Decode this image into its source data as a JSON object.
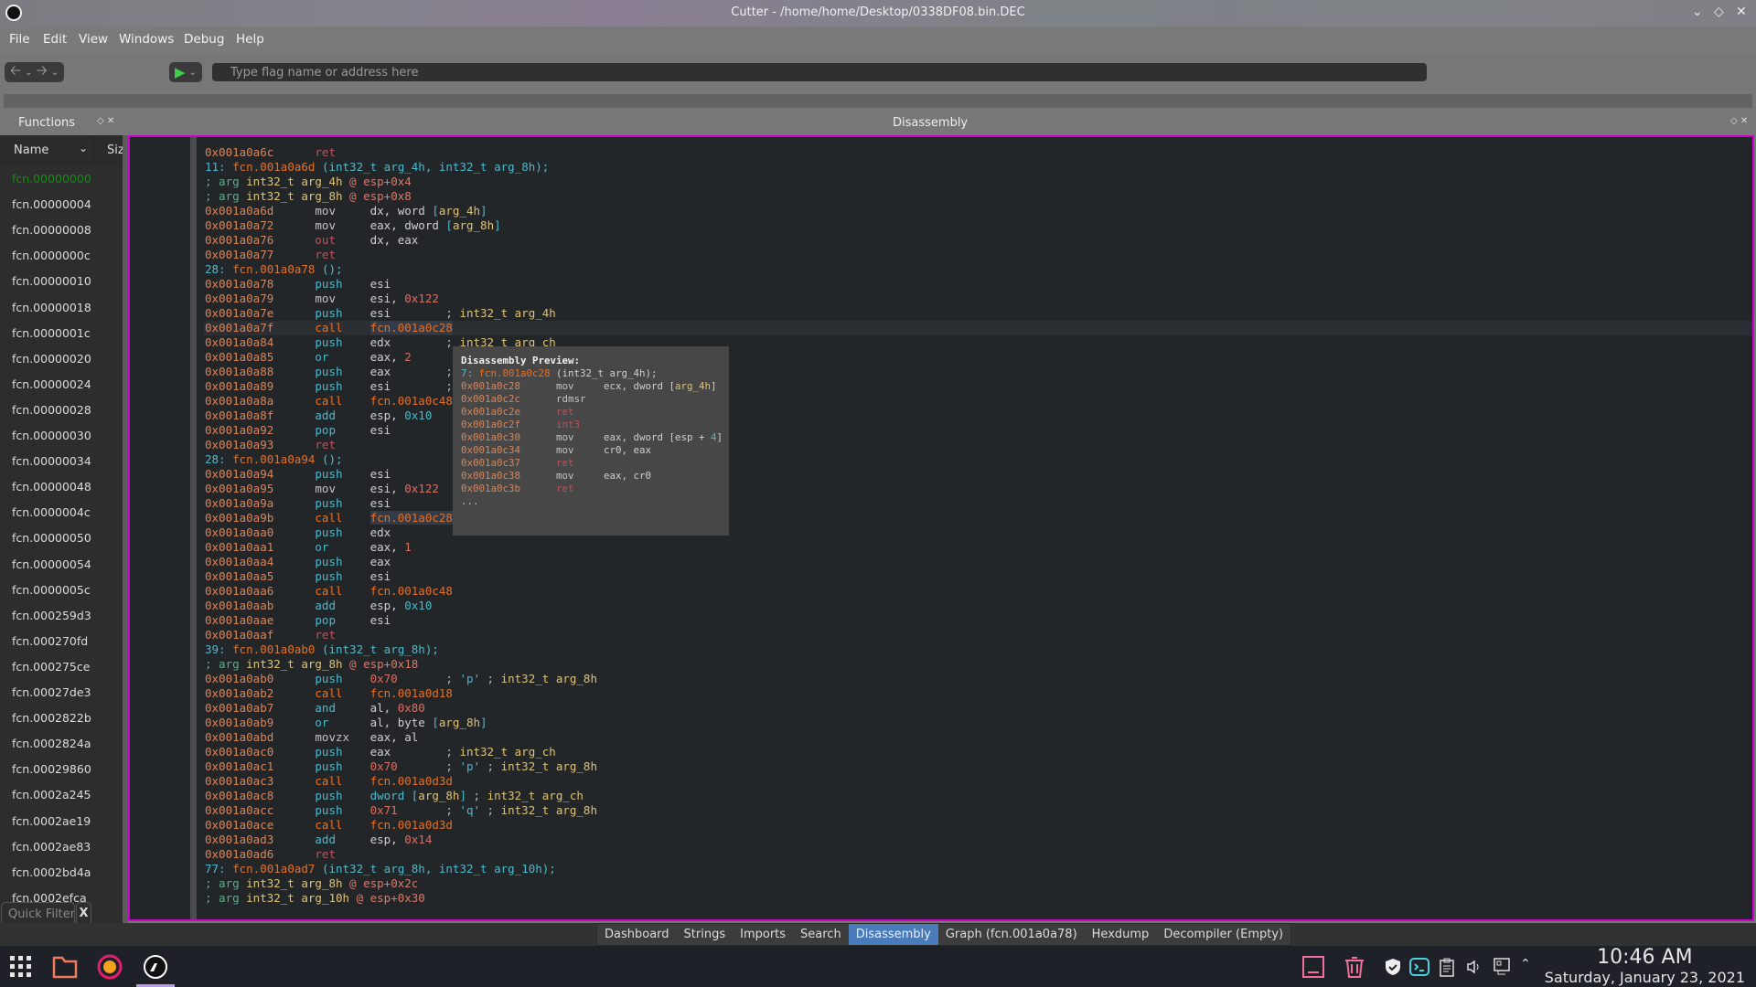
{
  "window": {
    "title": "Cutter - /home/home/Desktop/0338DF08.bin.DEC"
  },
  "menu": [
    "File",
    "Edit",
    "View",
    "Windows",
    "Debug",
    "Help"
  ],
  "toolbar": {
    "search_placeholder": "Type flag name or address here"
  },
  "functions_dock": {
    "title": "Functions",
    "col_name": "Name",
    "col_size": "Siz",
    "current": "fcn.00000000",
    "items": [
      "fcn.00000000",
      "fcn.00000004",
      "fcn.00000008",
      "fcn.0000000c",
      "fcn.00000010",
      "fcn.00000018",
      "fcn.0000001c",
      "fcn.00000020",
      "fcn.00000024",
      "fcn.00000028",
      "fcn.00000030",
      "fcn.00000034",
      "fcn.00000048",
      "fcn.0000004c",
      "fcn.00000050",
      "fcn.00000054",
      "fcn.0000005c",
      "fcn.000259d3",
      "fcn.000270fd",
      "fcn.000275ce",
      "fcn.00027de3",
      "fcn.0002822b",
      "fcn.0002824a",
      "fcn.00029860",
      "fcn.0002a245",
      "fcn.0002ae19",
      "fcn.0002ae83",
      "fcn.0002bd4a",
      "fcn.0002efca"
    ],
    "quick_filter_placeholder": "Quick Filter",
    "clear_label": "X"
  },
  "disassembly_dock": {
    "title": "Disassembly"
  },
  "disassembly": [
    {
      "addr": "0x001a0a6c",
      "mn": "ret",
      "k": "ret"
    },
    {
      "hdr": "11",
      "fcn": "fcn.001a0a6d",
      "sig": "(int32_t arg_4h, int32_t arg_8h);"
    },
    {
      "arg": "int32_t arg_4h",
      "at": "@ esp+0x4"
    },
    {
      "arg": "int32_t arg_8h",
      "at": "@ esp+0x8"
    },
    {
      "addr": "0x001a0a6d",
      "mn": "mov",
      "k": "mov",
      "ops": [
        [
          "dx, word ",
          "t"
        ],
        [
          "[",
          "b"
        ],
        [
          "arg_4h",
          "a"
        ],
        [
          "]",
          "b"
        ]
      ]
    },
    {
      "addr": "0x001a0a72",
      "mn": "mov",
      "k": "mov",
      "ops": [
        [
          "eax, dword ",
          "t"
        ],
        [
          "[",
          "b"
        ],
        [
          "arg_8h",
          "a"
        ],
        [
          "]",
          "b"
        ]
      ]
    },
    {
      "addr": "0x001a0a76",
      "mn": "out",
      "k": "ret",
      "ops": [
        [
          "dx, eax",
          "t"
        ]
      ]
    },
    {
      "addr": "0x001a0a77",
      "mn": "ret",
      "k": "ret"
    },
    {
      "hdr": "28",
      "fcn": "fcn.001a0a78",
      "sig": "();"
    },
    {
      "addr": "0x001a0a78",
      "mn": "push",
      "k": "push",
      "ops": [
        [
          "esi",
          "t"
        ]
      ]
    },
    {
      "addr": "0x001a0a79",
      "mn": "mov",
      "k": "mov",
      "ops": [
        [
          "esi, ",
          "t"
        ],
        [
          "0x122",
          "n"
        ]
      ]
    },
    {
      "addr": "0x001a0a7e",
      "mn": "push",
      "k": "push",
      "ops": [
        [
          "esi",
          "t"
        ]
      ],
      "cm": "int32_t arg_4h"
    },
    {
      "addr": "0x001a0a7f",
      "mn": "call",
      "k": "call",
      "ops": [
        [
          "fcn.001a0c28",
          "fh"
        ]
      ],
      "hl": true
    },
    {
      "addr": "0x001a0a84",
      "mn": "push",
      "k": "push",
      "ops": [
        [
          "edx",
          "t"
        ]
      ],
      "cm": "int32_t arg_ch"
    },
    {
      "addr": "0x001a0a85",
      "mn": "or",
      "k": "push",
      "ops": [
        [
          "eax, ",
          "t"
        ],
        [
          "2",
          "n"
        ]
      ]
    },
    {
      "addr": "0x001a0a88",
      "mn": "push",
      "k": "push",
      "ops": [
        [
          "eax",
          "t"
        ]
      ],
      "cm": ""
    },
    {
      "addr": "0x001a0a89",
      "mn": "push",
      "k": "push",
      "ops": [
        [
          "esi",
          "t"
        ]
      ],
      "cm": ""
    },
    {
      "addr": "0x001a0a8a",
      "mn": "call",
      "k": "call",
      "ops": [
        [
          "fcn.001a0c48",
          "f"
        ]
      ]
    },
    {
      "addr": "0x001a0a8f",
      "mn": "add",
      "k": "push",
      "ops": [
        [
          "esp, ",
          "t"
        ],
        [
          "0x10",
          "nc"
        ]
      ]
    },
    {
      "addr": "0x001a0a92",
      "mn": "pop",
      "k": "push",
      "ops": [
        [
          "esi",
          "t"
        ]
      ]
    },
    {
      "addr": "0x001a0a93",
      "mn": "ret",
      "k": "ret"
    },
    {
      "hdr": "28",
      "fcn": "fcn.001a0a94",
      "sig": "();"
    },
    {
      "addr": "0x001a0a94",
      "mn": "push",
      "k": "push",
      "ops": [
        [
          "esi",
          "t"
        ]
      ]
    },
    {
      "addr": "0x001a0a95",
      "mn": "mov",
      "k": "mov",
      "ops": [
        [
          "esi, ",
          "t"
        ],
        [
          "0x122",
          "n"
        ]
      ]
    },
    {
      "addr": "0x001a0a9a",
      "mn": "push",
      "k": "push",
      "ops": [
        [
          "esi",
          "t"
        ]
      ]
    },
    {
      "addr": "0x001a0a9b",
      "mn": "call",
      "k": "call",
      "ops": [
        [
          "fcn.001a0c28",
          "fh"
        ]
      ]
    },
    {
      "addr": "0x001a0aa0",
      "mn": "push",
      "k": "push",
      "ops": [
        [
          "edx",
          "t"
        ]
      ]
    },
    {
      "addr": "0x001a0aa1",
      "mn": "or",
      "k": "push",
      "ops": [
        [
          "eax, ",
          "t"
        ],
        [
          "1",
          "n"
        ]
      ]
    },
    {
      "addr": "0x001a0aa4",
      "mn": "push",
      "k": "push",
      "ops": [
        [
          "eax",
          "t"
        ]
      ]
    },
    {
      "addr": "0x001a0aa5",
      "mn": "push",
      "k": "push",
      "ops": [
        [
          "esi",
          "t"
        ]
      ]
    },
    {
      "addr": "0x001a0aa6",
      "mn": "call",
      "k": "call",
      "ops": [
        [
          "fcn.001a0c48",
          "f"
        ]
      ]
    },
    {
      "addr": "0x001a0aab",
      "mn": "add",
      "k": "push",
      "ops": [
        [
          "esp, ",
          "t"
        ],
        [
          "0x10",
          "nc"
        ]
      ]
    },
    {
      "addr": "0x001a0aae",
      "mn": "pop",
      "k": "push",
      "ops": [
        [
          "esi",
          "t"
        ]
      ]
    },
    {
      "addr": "0x001a0aaf",
      "mn": "ret",
      "k": "ret"
    },
    {
      "hdr": "39",
      "fcn": "fcn.001a0ab0",
      "sig": "(int32_t arg_8h);"
    },
    {
      "arg": "int32_t arg_8h",
      "at": "@ esp+0x18"
    },
    {
      "addr": "0x001a0ab0",
      "mn": "push",
      "k": "push",
      "ops": [
        [
          "0x70",
          "n"
        ]
      ],
      "str": "'p'",
      "cm": "int32_t arg_8h"
    },
    {
      "addr": "0x001a0ab2",
      "mn": "call",
      "k": "call",
      "ops": [
        [
          "fcn.001a0d18",
          "f"
        ]
      ]
    },
    {
      "addr": "0x001a0ab7",
      "mn": "and",
      "k": "push",
      "ops": [
        [
          "al, ",
          "t"
        ],
        [
          "0x80",
          "n"
        ]
      ]
    },
    {
      "addr": "0x001a0ab9",
      "mn": "or",
      "k": "push",
      "ops": [
        [
          "al, byte ",
          "t"
        ],
        [
          "[",
          "b"
        ],
        [
          "arg_8h",
          "a"
        ],
        [
          "]",
          "b"
        ]
      ]
    },
    {
      "addr": "0x001a0abd",
      "mn": "movzx",
      "k": "mov",
      "ops": [
        [
          "eax, al",
          "t"
        ]
      ]
    },
    {
      "addr": "0x001a0ac0",
      "mn": "push",
      "k": "push",
      "ops": [
        [
          "eax",
          "t"
        ]
      ],
      "cm": "int32_t arg_ch"
    },
    {
      "addr": "0x001a0ac1",
      "mn": "push",
      "k": "push",
      "ops": [
        [
          "0x70",
          "n"
        ]
      ],
      "str": "'p'",
      "cm": "int32_t arg_8h"
    },
    {
      "addr": "0x001a0ac3",
      "mn": "call",
      "k": "call",
      "ops": [
        [
          "fcn.001a0d3d",
          "f"
        ]
      ]
    },
    {
      "addr": "0x001a0ac8",
      "mn": "push",
      "k": "push",
      "ops": [
        [
          "dword ",
          "b"
        ],
        [
          "[",
          "b"
        ],
        [
          "arg_8h",
          "a"
        ],
        [
          "]",
          "b"
        ]
      ],
      "cm": "int32_t arg_ch"
    },
    {
      "addr": "0x001a0acc",
      "mn": "push",
      "k": "push",
      "ops": [
        [
          "0x71",
          "n"
        ]
      ],
      "str": "'q'",
      "cm": "int32_t arg_8h"
    },
    {
      "addr": "0x001a0ace",
      "mn": "call",
      "k": "call",
      "ops": [
        [
          "fcn.001a0d3d",
          "f"
        ]
      ]
    },
    {
      "addr": "0x001a0ad3",
      "mn": "add",
      "k": "push",
      "ops": [
        [
          "esp, ",
          "t"
        ],
        [
          "0x14",
          "n"
        ]
      ]
    },
    {
      "addr": "0x001a0ad6",
      "mn": "ret",
      "k": "ret"
    },
    {
      "hdr": "77",
      "fcn": "fcn.001a0ad7",
      "sig": "(int32_t arg_8h, int32_t arg_10h);"
    },
    {
      "arg": "int32_t arg_8h",
      "at": "@ esp+0x2c"
    },
    {
      "arg": "int32_t arg_10h",
      "at": "@ esp+0x30"
    }
  ],
  "preview": {
    "title": "Disassembly Preview:",
    "lines": [
      {
        "hdr": "7",
        "fcn": "fcn.001a0c28",
        "sig": "(int32_t arg_4h);",
        "plain": true
      },
      {
        "addr": "0x001a0c28",
        "mn": "mov",
        "k": "mov",
        "ops": [
          [
            "ecx, dword ",
            "t"
          ],
          [
            "[",
            "t"
          ],
          [
            "arg_4h",
            "a"
          ],
          [
            "]",
            "t"
          ]
        ]
      },
      {
        "addr": "0x001a0c2c",
        "mn": "rdmsr",
        "k": "mov"
      },
      {
        "addr": "0x001a0c2e",
        "mn": "ret",
        "k": "ret"
      },
      {
        "addr": "0x001a0c2f",
        "mn": "int3",
        "k": "ret"
      },
      {
        "addr": "0x001a0c30",
        "mn": "mov",
        "k": "mov",
        "ops": [
          [
            "eax, dword [esp + ",
            "t"
          ],
          [
            "4",
            "nc"
          ],
          [
            "]",
            "t"
          ]
        ]
      },
      {
        "addr": "0x001a0c34",
        "mn": "mov",
        "k": "mov",
        "ops": [
          [
            "cr0, eax",
            "t"
          ]
        ]
      },
      {
        "addr": "0x001a0c37",
        "mn": "ret",
        "k": "ret"
      },
      {
        "addr": "0x001a0c38",
        "mn": "mov",
        "k": "mov",
        "ops": [
          [
            "eax, cr0",
            "t"
          ]
        ]
      },
      {
        "addr": "0x001a0c3b",
        "mn": "ret",
        "k": "ret"
      },
      {
        "more": "..."
      }
    ]
  },
  "tabs": [
    {
      "label": "Dashboard"
    },
    {
      "label": "Strings"
    },
    {
      "label": "Imports"
    },
    {
      "label": "Search"
    },
    {
      "label": "Disassembly",
      "active": true
    },
    {
      "label": "Graph (fcn.001a0a78)"
    },
    {
      "label": "Hexdump"
    },
    {
      "label": "Decompiler (Empty)"
    }
  ],
  "taskbar": {
    "time": "10:46 AM",
    "date": "Saturday, January 23, 2021"
  },
  "colors": {
    "accent": "#4a7cbc",
    "dock_border": "#d000d0",
    "address": "#d4875e",
    "call": "#e8742a",
    "ret": "#b9545c",
    "push": "#4fb8cc",
    "current_function": "#109010"
  }
}
